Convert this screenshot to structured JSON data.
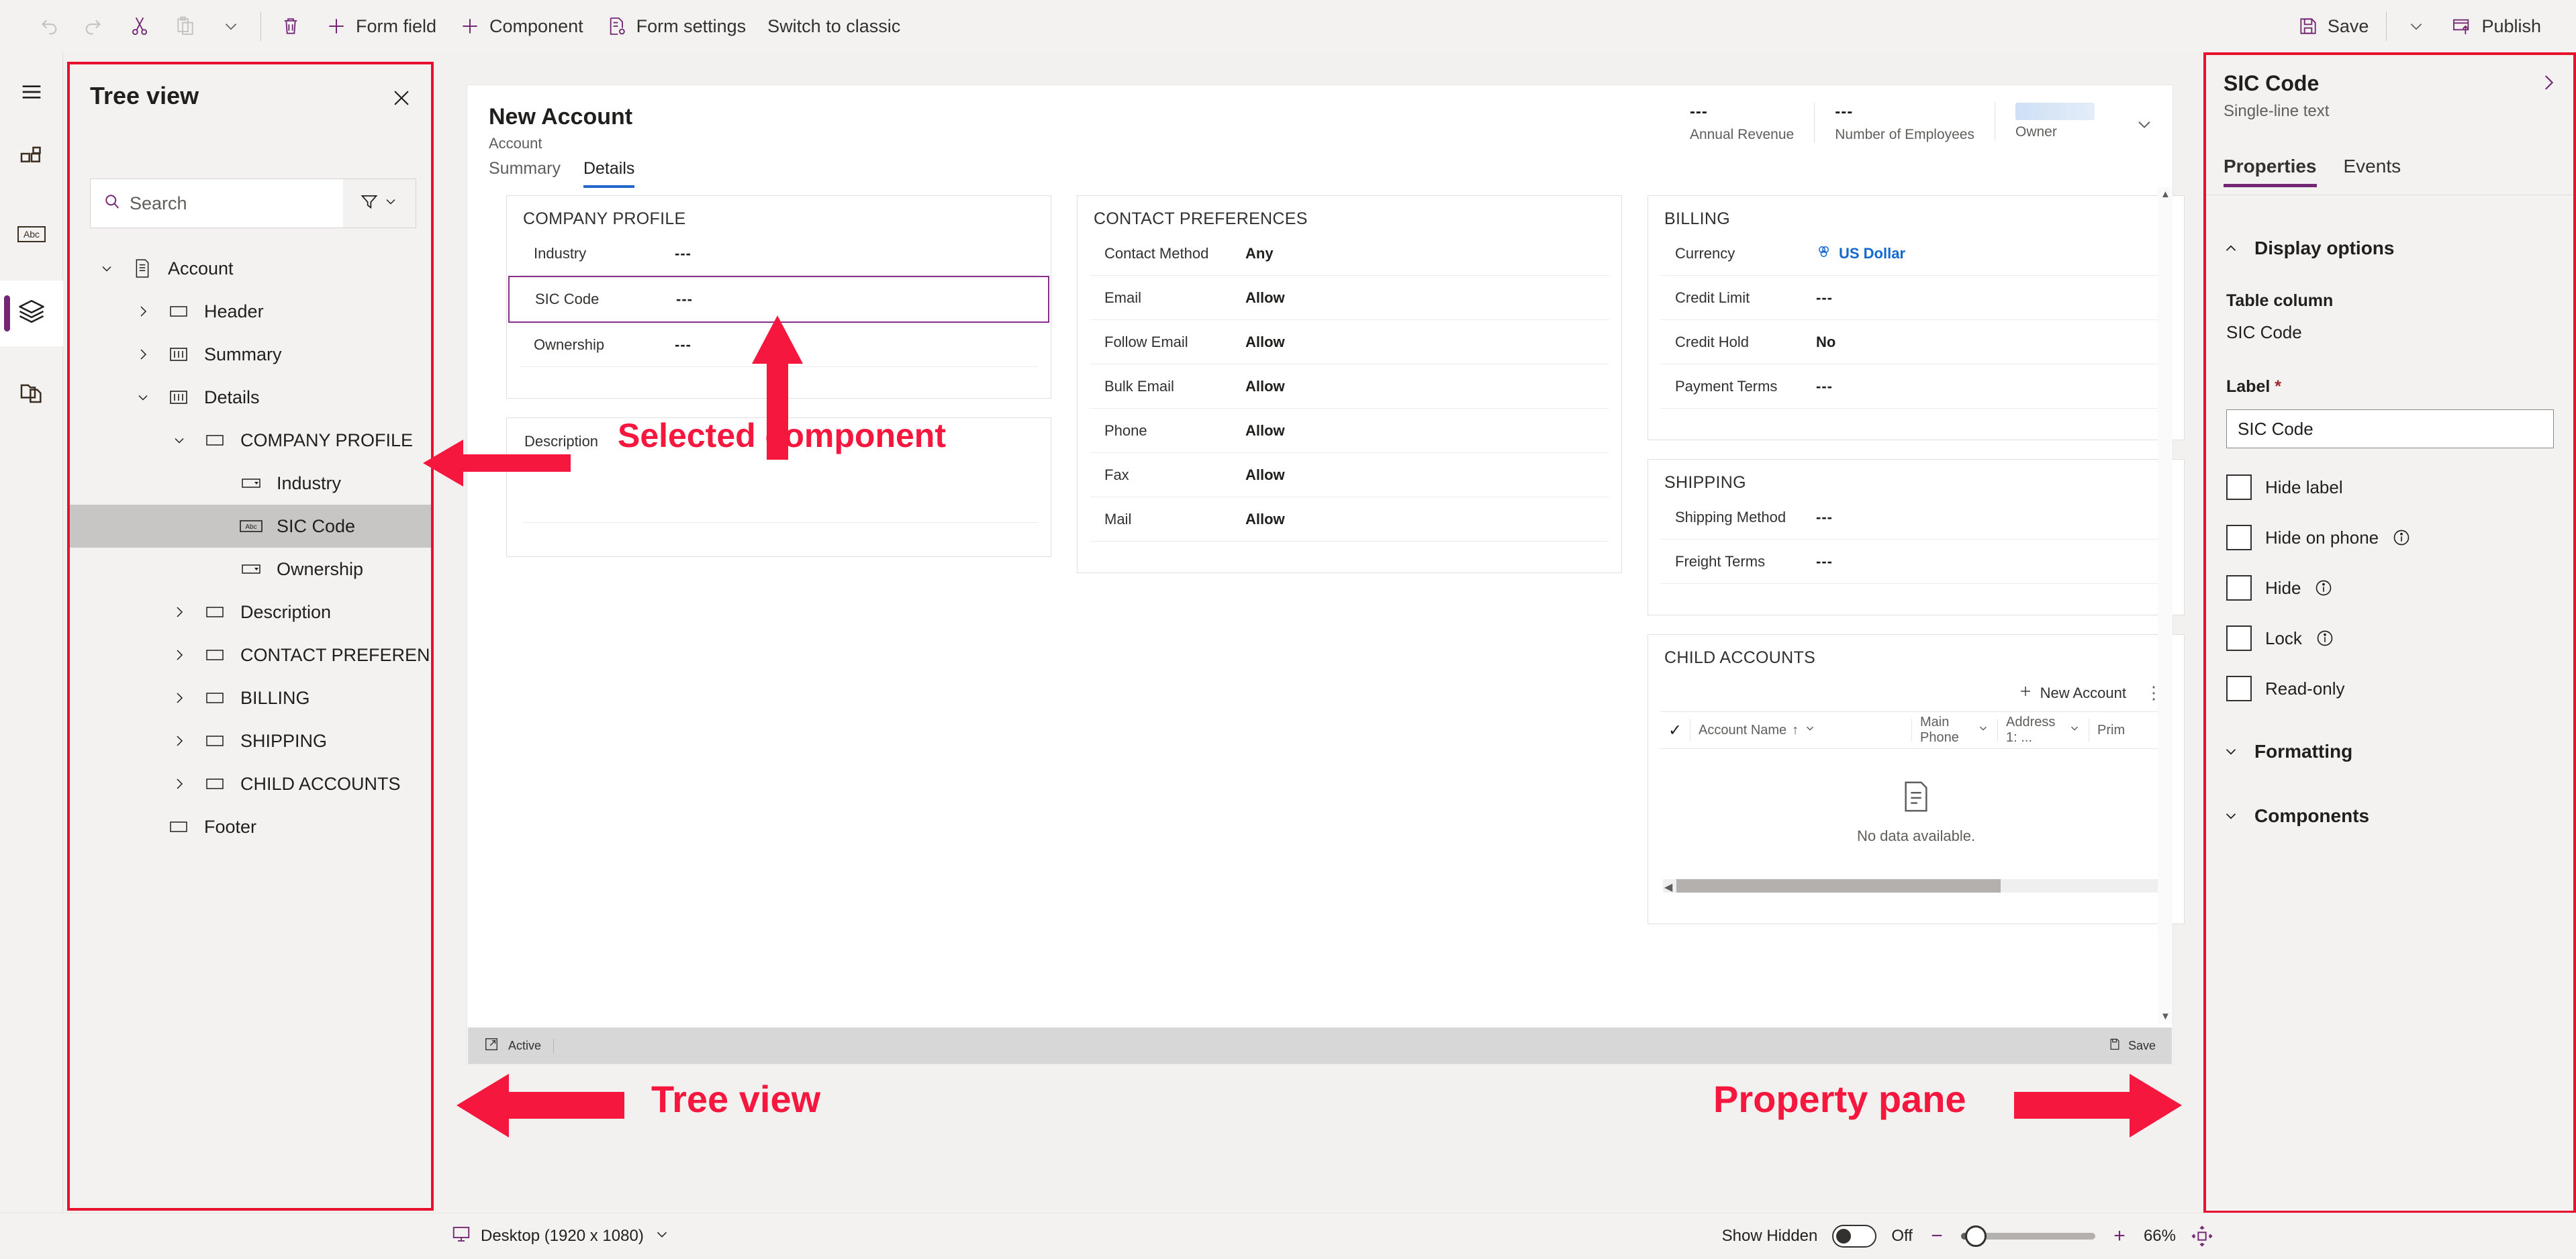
{
  "commandbar": {
    "left_items": [
      {
        "label": "",
        "icon": "undo-icon",
        "name": "undo-button",
        "disabled": true
      },
      {
        "label": "",
        "icon": "redo-icon",
        "name": "redo-button",
        "disabled": true
      },
      {
        "label": "",
        "icon": "cut-icon",
        "name": "cut-button",
        "disabled": false
      },
      {
        "label": "",
        "icon": "paste-icon",
        "name": "paste-button",
        "disabled": true
      },
      {
        "label": "",
        "icon": "chevron-down-icon",
        "name": "paste-options-button",
        "disabled": false
      },
      {
        "label": "",
        "icon": "delete-icon",
        "name": "delete-button",
        "disabled": false
      },
      {
        "label": "Form field",
        "icon": "plus-icon",
        "name": "form-field-button",
        "disabled": false
      },
      {
        "label": "Component",
        "icon": "plus-icon",
        "name": "component-button",
        "disabled": false
      },
      {
        "label": "Form settings",
        "icon": "form-settings-icon",
        "name": "form-settings-button",
        "disabled": false
      },
      {
        "label": "Switch to classic",
        "icon": "",
        "name": "switch-to-classic-button",
        "disabled": false
      }
    ],
    "save_label": "Save",
    "publish_label": "Publish"
  },
  "rail": {
    "items": [
      {
        "name": "hamburger-menu-icon",
        "label": "Menu"
      },
      {
        "name": "components-icon",
        "label": "Components"
      },
      {
        "name": "fields-abc-icon",
        "label": "Table columns"
      },
      {
        "name": "layers-tree-icon",
        "label": "Tree view",
        "active": true
      },
      {
        "name": "related-files-icon",
        "label": "Related"
      }
    ]
  },
  "tree_view": {
    "title": "Tree view",
    "close_label": "Close",
    "search_placeholder": "Search",
    "search_value": "",
    "filter_label": "Filter",
    "nodes": [
      {
        "label": "Account",
        "depth": 0,
        "icon": "form-icon",
        "chevron": "down",
        "selected": false
      },
      {
        "label": "Header",
        "depth": 1,
        "icon": "section-icon",
        "chevron": "right",
        "selected": false
      },
      {
        "label": "Summary",
        "depth": 1,
        "icon": "tab-icon",
        "chevron": "right",
        "selected": false
      },
      {
        "label": "Details",
        "depth": 1,
        "icon": "tab-icon",
        "chevron": "down",
        "selected": false
      },
      {
        "label": "COMPANY PROFILE",
        "depth": 2,
        "icon": "section-icon",
        "chevron": "down",
        "selected": false
      },
      {
        "label": "Industry",
        "depth": 3,
        "icon": "choice-icon",
        "chevron": "none",
        "selected": false
      },
      {
        "label": "SIC Code",
        "depth": 3,
        "icon": "abc-icon",
        "chevron": "none",
        "selected": true
      },
      {
        "label": "Ownership",
        "depth": 3,
        "icon": "choice-icon",
        "chevron": "none",
        "selected": false
      },
      {
        "label": "Description",
        "depth": 2,
        "icon": "section-icon",
        "chevron": "right",
        "selected": false
      },
      {
        "label": "CONTACT PREFEREN...",
        "depth": 2,
        "icon": "section-icon",
        "chevron": "right",
        "selected": false
      },
      {
        "label": "BILLING",
        "depth": 2,
        "icon": "section-icon",
        "chevron": "right",
        "selected": false
      },
      {
        "label": "SHIPPING",
        "depth": 2,
        "icon": "section-icon",
        "chevron": "right",
        "selected": false
      },
      {
        "label": "CHILD ACCOUNTS",
        "depth": 2,
        "icon": "section-icon",
        "chevron": "right",
        "selected": false
      },
      {
        "label": "Footer",
        "depth": 1,
        "icon": "section-icon",
        "chevron": "none",
        "selected": false
      }
    ]
  },
  "form": {
    "title": "New Account",
    "subtitle": "Account",
    "header_fields": [
      {
        "value": "---",
        "label": "Annual Revenue"
      },
      {
        "value": "---",
        "label": "Number of Employees"
      },
      {
        "value": "",
        "label": "Owner"
      }
    ],
    "tabs": [
      {
        "label": "Summary",
        "active": false
      },
      {
        "label": "Details",
        "active": true
      }
    ],
    "company_profile": {
      "title": "COMPANY PROFILE",
      "rows": [
        {
          "label": "Industry",
          "value": "---",
          "selected": false
        },
        {
          "label": "SIC Code",
          "value": "---",
          "selected": true
        },
        {
          "label": "Ownership",
          "value": "---",
          "selected": false
        }
      ]
    },
    "description": {
      "label": "Description"
    },
    "contact_preferences": {
      "title": "CONTACT PREFERENCES",
      "rows": [
        {
          "label": "Contact Method",
          "value": "Any"
        },
        {
          "label": "Email",
          "value": "Allow"
        },
        {
          "label": "Follow Email",
          "value": "Allow"
        },
        {
          "label": "Bulk Email",
          "value": "Allow"
        },
        {
          "label": "Phone",
          "value": "Allow"
        },
        {
          "label": "Fax",
          "value": "Allow"
        },
        {
          "label": "Mail",
          "value": "Allow"
        }
      ]
    },
    "billing": {
      "title": "BILLING",
      "currency_label": "Currency",
      "currency_value": "US Dollar",
      "rows": [
        {
          "label": "Credit Limit",
          "value": "---"
        },
        {
          "label": "Credit Hold",
          "value": "No"
        },
        {
          "label": "Payment Terms",
          "value": "---"
        }
      ]
    },
    "shipping": {
      "title": "SHIPPING",
      "rows": [
        {
          "label": "Shipping Method",
          "value": "---"
        },
        {
          "label": "Freight Terms",
          "value": "---"
        }
      ]
    },
    "child_accounts": {
      "title": "CHILD ACCOUNTS",
      "new_label": "New Account",
      "more_label": "⋮",
      "columns": [
        "Account Name",
        "Main Phone",
        "Address 1: ...",
        "Prim"
      ],
      "sort_indicator": "↑",
      "empty_text": "No data available."
    },
    "status": {
      "active_label": "Active",
      "save_label": "Save"
    }
  },
  "properties": {
    "title": "SIC Code",
    "subtitle": "Single-line text",
    "tabs": [
      {
        "label": "Properties",
        "active": true
      },
      {
        "label": "Events",
        "active": false
      }
    ],
    "display_options_label": "Display options",
    "table_column_label": "Table column",
    "table_column_value": "SIC Code",
    "label_label": "Label",
    "label_required": "*",
    "label_value": "SIC Code",
    "checkboxes": [
      {
        "label": "Hide label",
        "checked": false,
        "info": false
      },
      {
        "label": "Hide on phone",
        "checked": false,
        "info": true
      },
      {
        "label": "Hide",
        "checked": false,
        "info": true
      },
      {
        "label": "Lock",
        "checked": false,
        "info": true
      },
      {
        "label": "Read-only",
        "checked": false,
        "info": false
      }
    ],
    "formatting_label": "Formatting",
    "components_label": "Components"
  },
  "bottom_bar": {
    "device_label": "Desktop (1920 x 1080)",
    "show_hidden_label": "Show Hidden",
    "show_hidden_state": "Off",
    "zoom_percent": "66%",
    "zoom_out_label": "−",
    "zoom_in_label": "+"
  },
  "annotations": [
    {
      "text": "Selected component",
      "name": "annotation-selected-component"
    },
    {
      "text": "Tree view",
      "name": "annotation-tree-view"
    },
    {
      "text": "Property pane",
      "name": "annotation-property-pane"
    }
  ],
  "colors": {
    "accent_purple": "#742774",
    "annotation_red": "#f5173e",
    "highlight_border": "#e8112d",
    "tab_blue": "#2266cc",
    "link_blue": "#1268cf"
  }
}
